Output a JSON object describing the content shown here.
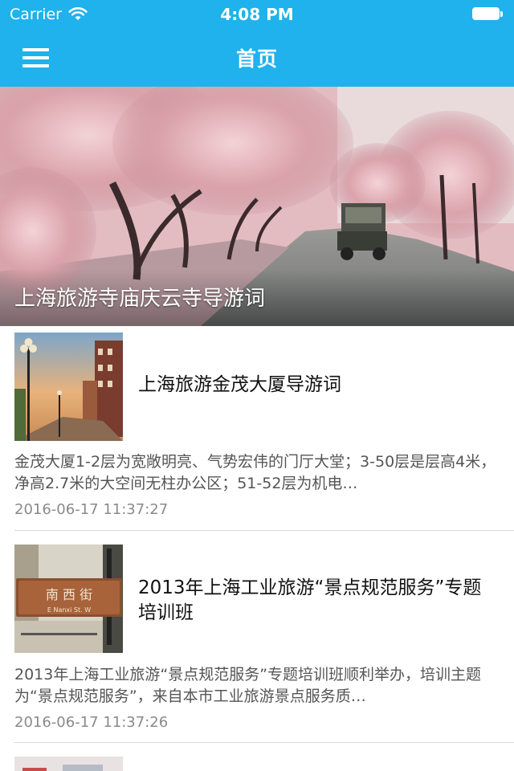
{
  "status_bar": {
    "carrier": "Carrier",
    "time": "4:08 PM",
    "wifi_icon": "wifi-icon",
    "battery_icon": "battery-full-icon"
  },
  "nav": {
    "title": "首页",
    "menu_icon": "hamburger-menu-icon",
    "background_color": "#1fb2ec"
  },
  "banner": {
    "title": "上海旅游寺庙庆云寺导游词"
  },
  "articles": [
    {
      "title": "上海旅游金茂大厦导游词",
      "summary": "金茂大厦1-2层为宽敞明亮、气势宏伟的门厅大堂；3-50层是层高4米，净高2.7米的大空间无柱办公区；51-52层为机电…",
      "time": "2016-06-17 11:37:27"
    },
    {
      "title": "2013年上海工业旅游“景点规范服务”专题培训班",
      "summary": "2013年上海工业旅游“景点规范服务”专题培训班顺利举办，培训主题为“景点规范服务”，来自本市工业旅游景点服务质…",
      "time": "2016-06-17 11:37:26",
      "thumb_sign_text": "南 西 街",
      "thumb_sign_sub": "E   Nanxi St.   W"
    }
  ]
}
